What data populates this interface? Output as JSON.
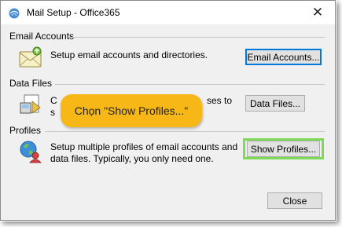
{
  "window": {
    "title": "Mail Setup - Office365",
    "close_glyph": "✕"
  },
  "email_accounts": {
    "heading": "Email Accounts",
    "description": "Setup email accounts and directories.",
    "button_label": "Email Accounts...",
    "icon": "mail-envelope-icon"
  },
  "data_files": {
    "heading": "Data Files",
    "description_left": "C",
    "description_left_line2": "s",
    "description_right": "ses to",
    "button_label": "Data Files...",
    "icon": "data-file-icon"
  },
  "profiles": {
    "heading": "Profiles",
    "description_line1": "Setup multiple profiles of email accounts and",
    "description_line2": "data files. Typically, you only need one.",
    "button_label": "Show Profiles...",
    "icon": "profile-globe-icon"
  },
  "footer": {
    "close_label": "Close"
  },
  "callout": {
    "text": "Chọn \"Show Profiles...\""
  },
  "colors": {
    "callout_bg": "#f7b817",
    "highlight": "#7ed957",
    "focus_border": "#0078d7"
  }
}
